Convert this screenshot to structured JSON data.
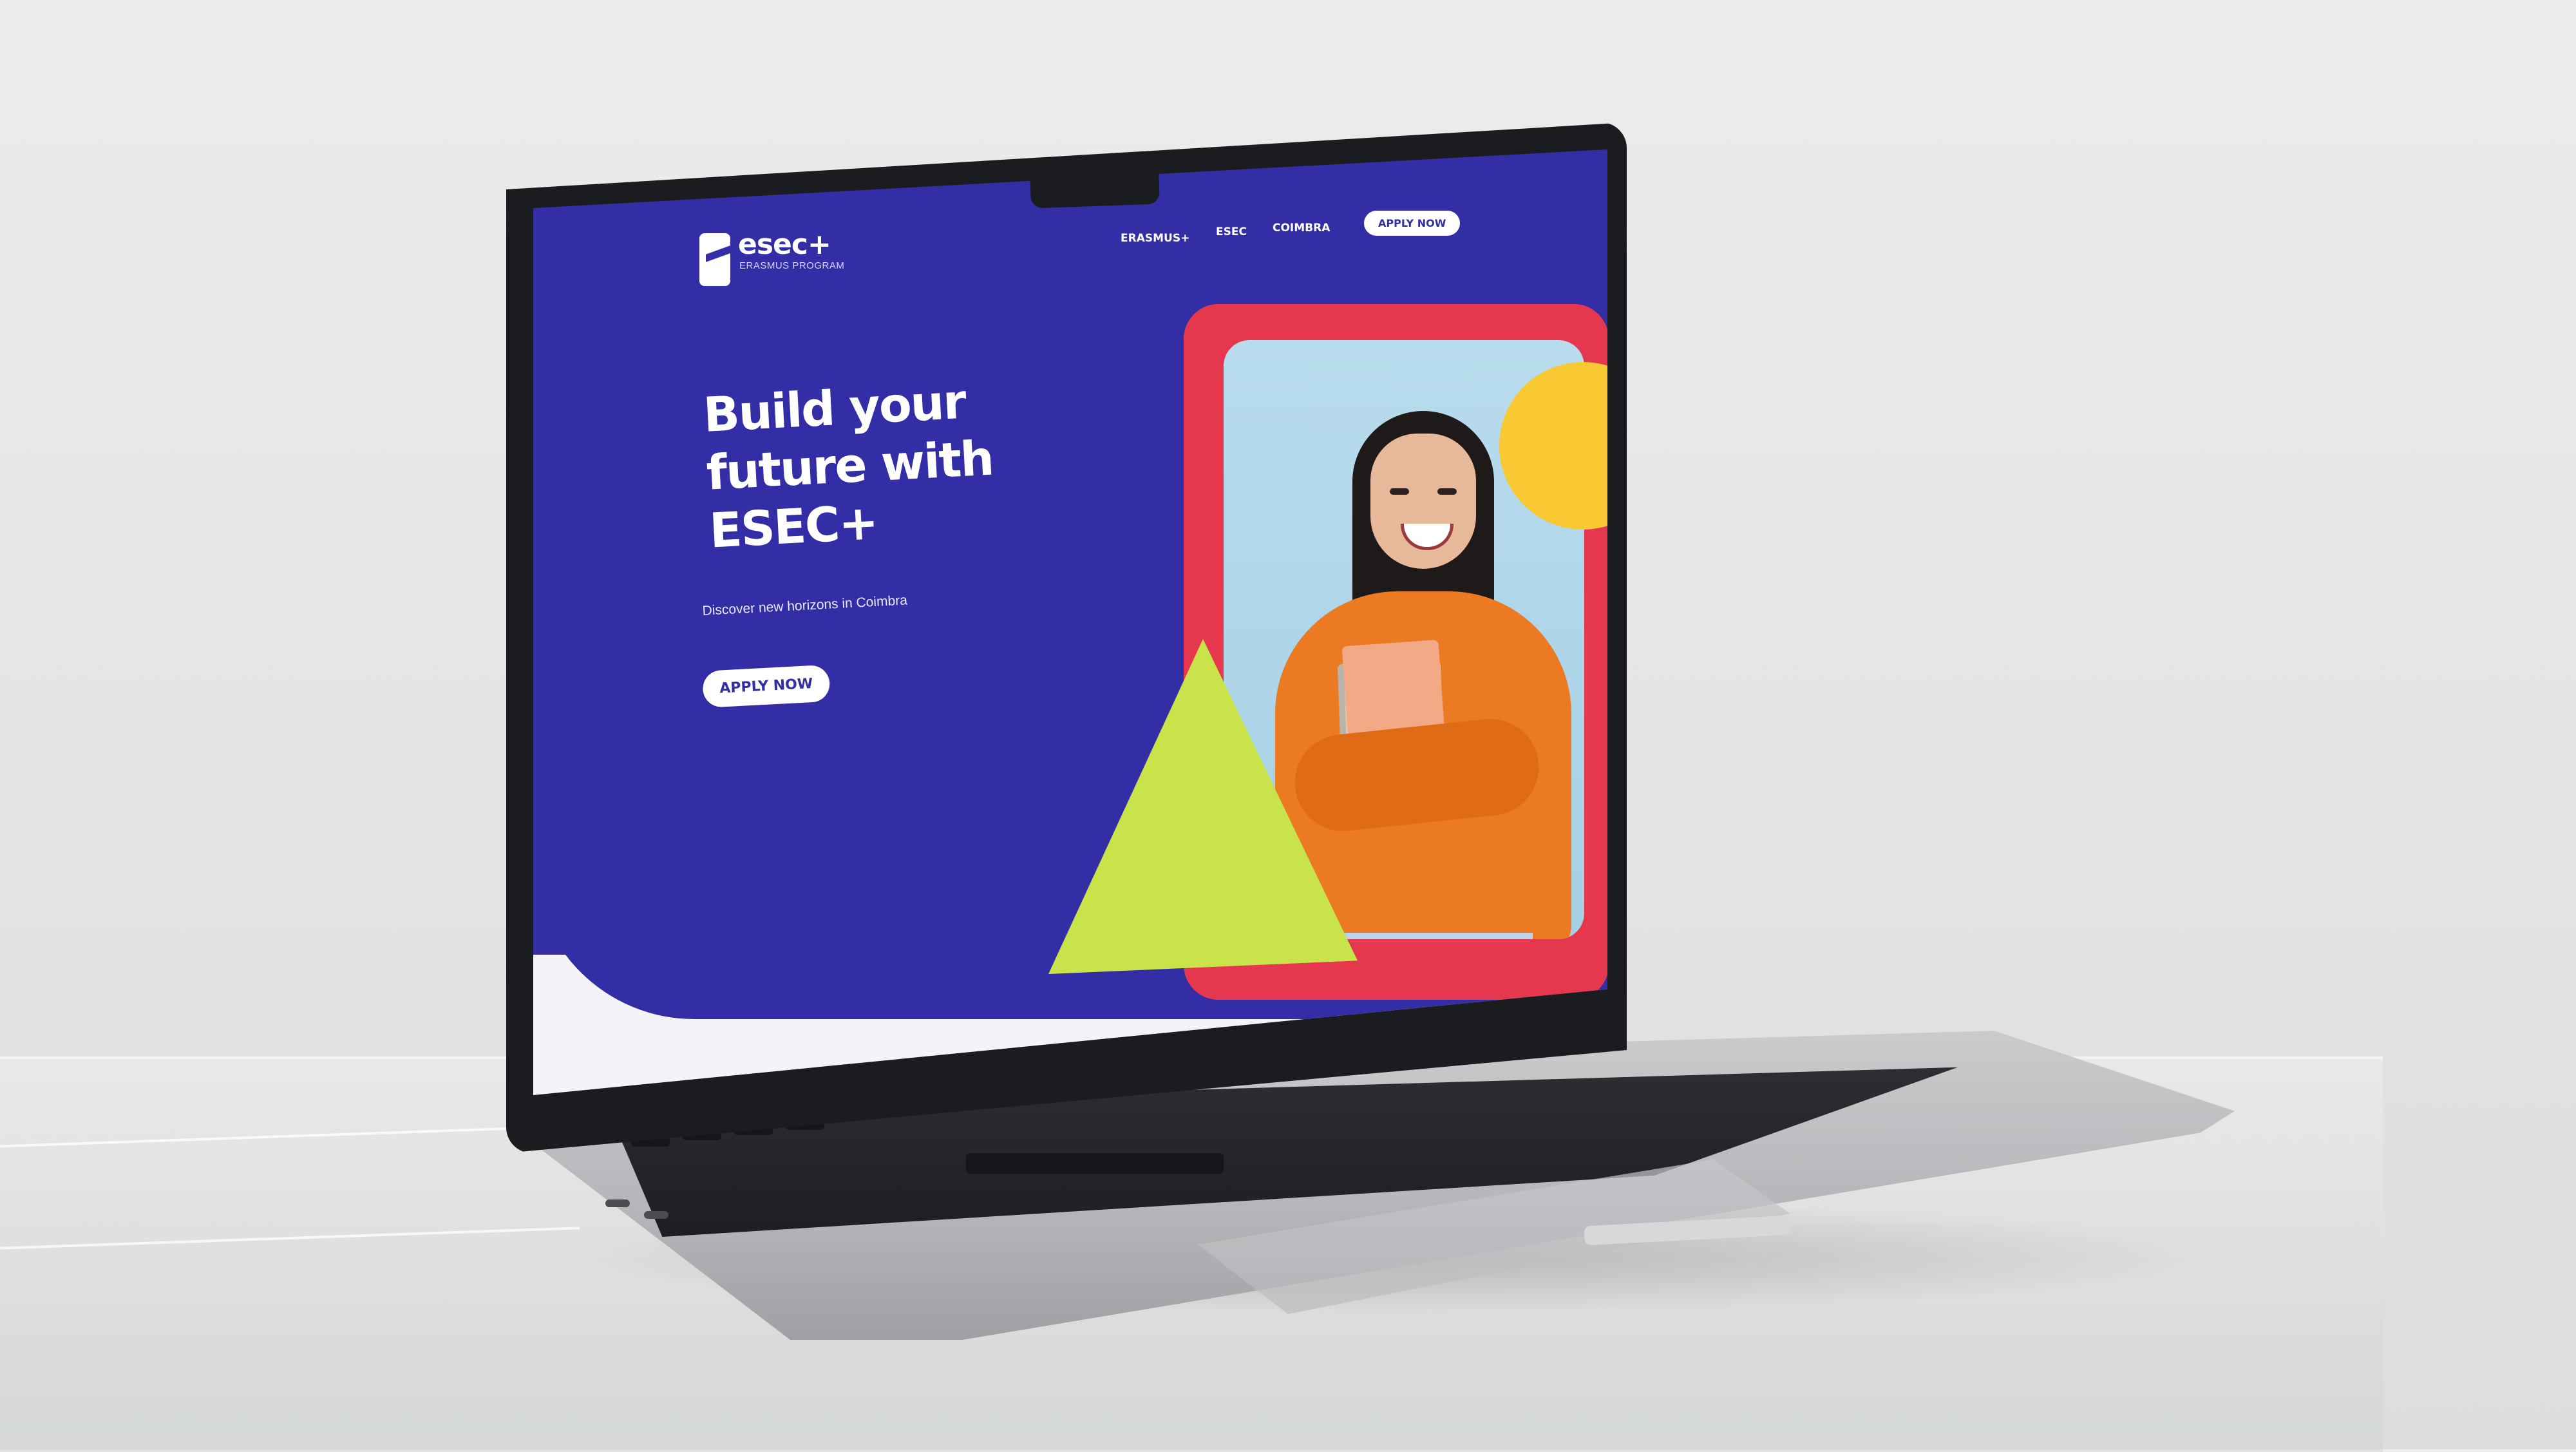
{
  "site": {
    "logo": {
      "name": "esec+",
      "subtitle": "ERASMUS PROGRAM"
    },
    "nav": {
      "items": [
        {
          "label": "ERASMUS+"
        },
        {
          "label": "ESEC"
        },
        {
          "label": "COIMBRA"
        }
      ],
      "cta_label": "APPLY NOW"
    },
    "hero": {
      "title": "Build your\nfuture with\nESEC+",
      "subtitle": "Discover new horizons in Coimbra",
      "cta_label": "APPLY NOW"
    }
  },
  "colors": {
    "primary_blue": "#342ea6",
    "accent_red": "#e5384f",
    "accent_yellow": "#f9c933",
    "accent_green": "#c9e44a",
    "photo_bg": "#b8dced"
  },
  "illustration": {
    "person": "student-holding-notebooks"
  }
}
